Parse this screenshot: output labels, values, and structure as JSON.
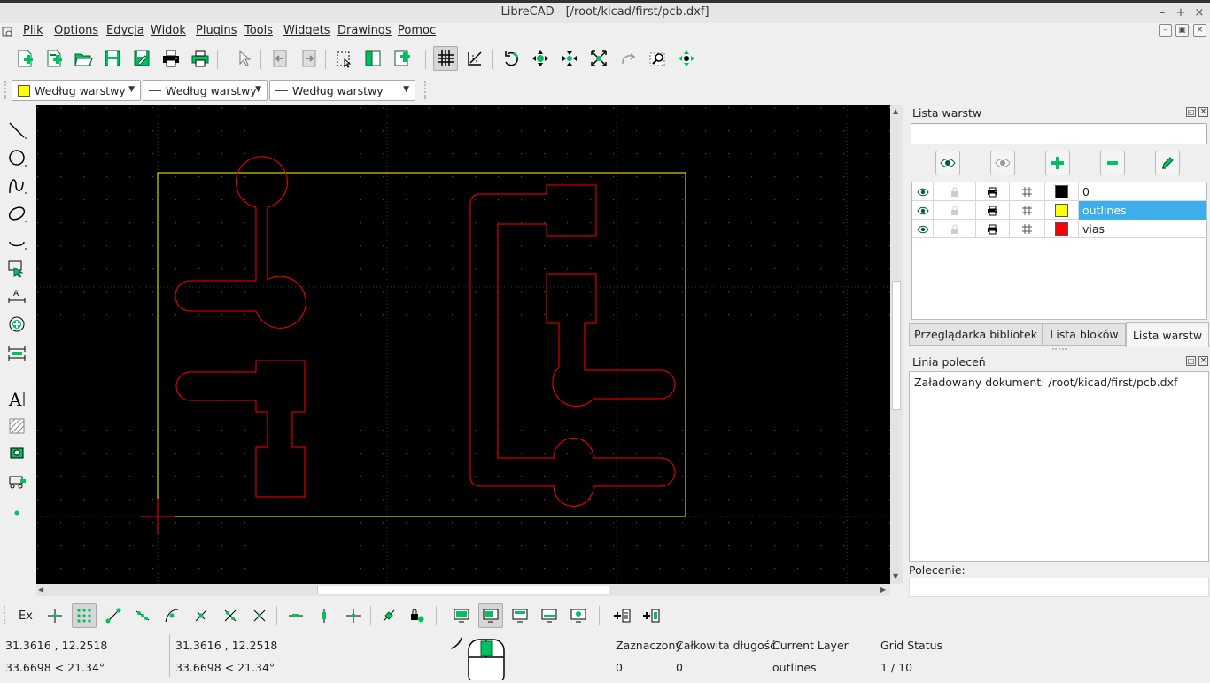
{
  "window": {
    "title": "LibreCAD - [/root/kicad/first/pcb.dxf]"
  },
  "menu": {
    "items": [
      "Plik",
      "Options",
      "Edycja",
      "Widok",
      "Plugins",
      "Tools",
      "Widgets",
      "Drawings",
      "Pomoc"
    ]
  },
  "toolbar2": {
    "color_combo": "Według warstwy",
    "width_combo": "Według warstwy",
    "linetype_combo": "Według warstwy"
  },
  "colors": {
    "canvas_bg": "#000000",
    "outline": "#ffff00",
    "trace": "#ff0000",
    "accent": "#3daee9",
    "icon_green": "#00c060"
  },
  "layers_panel": {
    "title": "Lista warstw",
    "filter_value": "",
    "layers": [
      {
        "name": "0",
        "color": "#000000",
        "selected": false
      },
      {
        "name": "outlines",
        "color": "#ffff00",
        "selected": true
      },
      {
        "name": "vias",
        "color": "#ff0000",
        "selected": false
      }
    ],
    "tabs": [
      "Przeglądarka bibliotek",
      "Lista bloków",
      "Lista warstw"
    ],
    "active_tab": "Lista warstw"
  },
  "command_panel": {
    "title": "Linia poleceń",
    "output": "Załadowany dokument: /root/kicad/first/pcb.dxf",
    "prompt_label": "Polecenie:",
    "input_value": ""
  },
  "bottom_toolbar": {
    "ex_label": "Ex"
  },
  "status": {
    "abs_coord": "31.3616 , 12.2518",
    "abs_polar": "33.6698 < 21.34°",
    "rel_coord": "31.3616 , 12.2518",
    "rel_polar": "33.6698 < 21.34°",
    "selected_label": "Zaznaczony",
    "selected_value": "0",
    "length_label": "Całkowita długość",
    "length_value": "0",
    "layer_label": "Current Layer",
    "layer_value": "outlines",
    "grid_label": "Grid Status",
    "grid_value": "1 / 10"
  }
}
